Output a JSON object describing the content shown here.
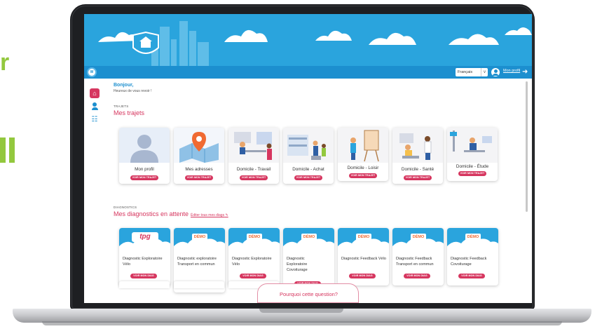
{
  "side_text": "r",
  "navbar": {
    "logo_text": "W",
    "language": "Français",
    "language_chevron": "v",
    "profile_link": "Mon profil",
    "logout_glyph": "➜"
  },
  "leftnav": {
    "home_glyph": "⌂",
    "group_glyph": "☷"
  },
  "greeting": {
    "title": "Bonjour,",
    "subtitle": "Heureux de vous revoir !"
  },
  "trajets": {
    "caption": "TRAJETS",
    "title": "Mes trajets",
    "button_label": "VOIR MON TRAJET",
    "cards": [
      {
        "label": "Mon profil"
      },
      {
        "label": "Mes adresses"
      },
      {
        "label": "Domicile - Travail"
      },
      {
        "label": "Domicile - Achat"
      },
      {
        "label": "Domicile - Loisir"
      },
      {
        "label": "Domicile - Santé"
      },
      {
        "label": "Domicile - Étude"
      }
    ]
  },
  "diagnostics": {
    "caption": "DIAGNOSTICS",
    "title": "Mes diagnostics en attente",
    "edit_link": "Éditer tous mes diags",
    "button_label": "VOIR MON DIAG",
    "cards": [
      {
        "badge": "tpg",
        "label": "Diagnostic Exploratoire Vélo"
      },
      {
        "badge": "DÉMO",
        "label": "Diagnostic exploratoire Transport en commun"
      },
      {
        "badge": "DÉMO",
        "label": "Diagnostic Exploratoire Vélo"
      },
      {
        "badge": "DÉMO",
        "label": "Diagnostic Exploratoire Covoiturage"
      },
      {
        "badge": "DÉMO",
        "label": "Diagnostic Feedback Vélo"
      },
      {
        "badge": "DÉMO",
        "label": "Diagnostic Feedback Transport en commun"
      },
      {
        "badge": "DÉMO",
        "label": "Diagnostic Feedback Covoiturage"
      }
    ]
  },
  "footer_button": "Pourquoi cette question?",
  "colors": {
    "primary_blue": "#1c8fcf",
    "accent_pink": "#d6365f",
    "side_green": "#93c83e"
  }
}
